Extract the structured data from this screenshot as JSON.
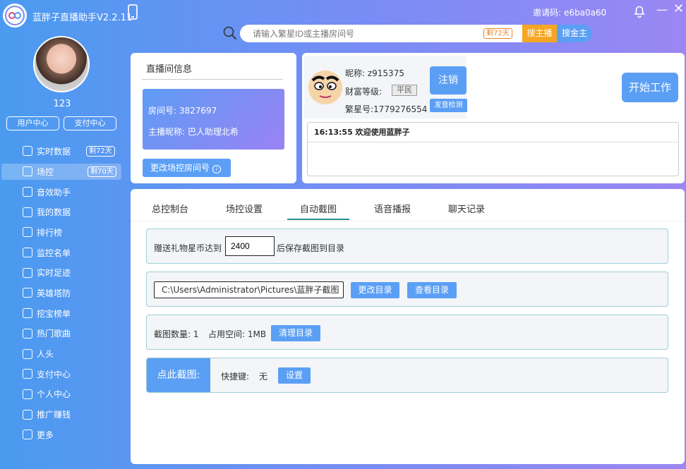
{
  "app": {
    "title": "蓝胖子直播助手V2.2.11"
  },
  "header": {
    "invite_label": "邀请码:",
    "invite_code": "e6ba0a60"
  },
  "search": {
    "placeholder": "请输入繁星ID或主播房间号",
    "badge": "剩72天",
    "search_host": "搜主播",
    "search_all": "搜金主"
  },
  "sidebar": {
    "username": "123",
    "user_center": "用户中心",
    "pay_center": "支付中心",
    "items": [
      {
        "label": "实时数据",
        "badge": "剩72天",
        "icon": "monitor-icon"
      },
      {
        "label": "场控",
        "badge": "剩70天",
        "icon": "gamepad-icon",
        "active": true
      },
      {
        "label": "音效助手",
        "badge": "",
        "icon": "sound-effect-icon"
      },
      {
        "label": "我的数据",
        "badge": "",
        "icon": "microphone-icon"
      },
      {
        "label": "排行榜",
        "badge": "",
        "icon": "sort-icon"
      },
      {
        "label": "监控名单",
        "badge": "",
        "icon": "monitor-list-icon"
      },
      {
        "label": "实时足迹",
        "badge": "",
        "icon": "footprint-icon"
      },
      {
        "label": "英雄塔防",
        "badge": "",
        "icon": "gamepad-icon"
      },
      {
        "label": "挖宝榜单",
        "badge": "",
        "icon": "gift-icon"
      },
      {
        "label": "热门歌曲",
        "badge": "",
        "icon": "music-note-icon"
      },
      {
        "label": "人头",
        "badge": "",
        "icon": "gift-icon"
      },
      {
        "label": "支付中心",
        "badge": "",
        "icon": "wallet-icon"
      },
      {
        "label": "个人中心",
        "badge": "",
        "icon": "gear-icon"
      },
      {
        "label": "推广赚钱",
        "badge": "",
        "icon": "share-icon"
      },
      {
        "label": "更多",
        "badge": "",
        "icon": "grid-icon"
      }
    ]
  },
  "room_info": {
    "title": "直播间信息",
    "room_number": "房间号: 3827697",
    "host_nickname": "主播昵称: 巴人助理北希",
    "change_button": "更改场控房间号"
  },
  "user_info": {
    "nickname": "昵称:  z915375",
    "wealth_label": "财富等级:",
    "wealth_level": "平民",
    "fanxing_id": "繁星号:1779276554",
    "logout": "注销",
    "speech_test": "发音检测",
    "start_work": "开始工作"
  },
  "log": {
    "entries": [
      "16:13:55 欢迎使用蓝胖子"
    ]
  },
  "tabs": [
    "总控制台",
    "场控设置",
    "自动截图",
    "语音播报",
    "聊天记录"
  ],
  "active_tab": "自动截图",
  "screenshot": {
    "gift_label_prefix": "赠送礼物星币达到",
    "gift_threshold": "2400",
    "gift_label_suffix": "后保存截图到目录",
    "save_path": "C:\\Users\\Administrator\\Pictures\\蓝胖子截图",
    "change_dir": "更改目录",
    "view_dir": "查看目录",
    "count_label": "截图数量: 1",
    "space_label": "占用空间: 1MB",
    "clean_dir": "清理目录",
    "click_capture": "点此截图:",
    "hotkey_label": "快捷键:",
    "hotkey_value": "无",
    "set_button": "设置"
  },
  "colors": {
    "accent": "#5b9ff5",
    "search_host": "#f5a623",
    "badge": "#e8852c",
    "tab_underline": "#2a8c8c"
  }
}
